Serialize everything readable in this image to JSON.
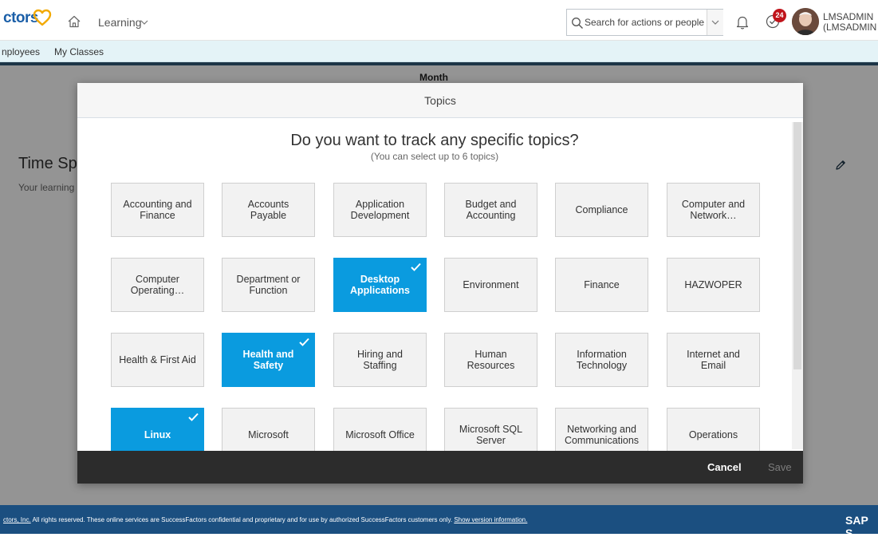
{
  "header": {
    "logo_text": "ctors",
    "module": "Learning",
    "search": {
      "placeholder": "Search for actions or people"
    },
    "todo_badge": "24",
    "user": {
      "line1": "LMSADMIN",
      "line2": "(LMSADMIN"
    }
  },
  "subnav": {
    "items": [
      "nployees",
      "My Classes"
    ]
  },
  "background": {
    "month_label": "Month",
    "time_spent_title": "Time Sp",
    "time_spent_sub": "Your learning"
  },
  "dialog": {
    "title": "Topics",
    "question": "Do you want to track any specific topics?",
    "hint": "(You can select up to 6 topics)",
    "topics": [
      {
        "label": "Accounting and Finance",
        "selected": false
      },
      {
        "label": "Accounts Payable",
        "selected": false
      },
      {
        "label": "Application Development",
        "selected": false
      },
      {
        "label": "Budget and Accounting",
        "selected": false
      },
      {
        "label": "Compliance",
        "selected": false
      },
      {
        "label": "Computer and Network…",
        "selected": false
      },
      {
        "label": "Computer Operating…",
        "selected": false
      },
      {
        "label": "Department or Function",
        "selected": false
      },
      {
        "label": "Desktop Applications",
        "selected": true
      },
      {
        "label": "Environment",
        "selected": false
      },
      {
        "label": "Finance",
        "selected": false
      },
      {
        "label": "HAZWOPER",
        "selected": false
      },
      {
        "label": "Health & First Aid",
        "selected": false
      },
      {
        "label": "Health and Safety",
        "selected": true
      },
      {
        "label": "Hiring and Staffing",
        "selected": false
      },
      {
        "label": "Human Resources",
        "selected": false
      },
      {
        "label": "Information Technology",
        "selected": false
      },
      {
        "label": "Internet and Email",
        "selected": false
      },
      {
        "label": "Linux",
        "selected": true
      },
      {
        "label": "Microsoft",
        "selected": false
      },
      {
        "label": "Microsoft Office",
        "selected": false
      },
      {
        "label": "Microsoft SQL Server",
        "selected": false
      },
      {
        "label": "Networking and Communications",
        "selected": false
      },
      {
        "label": "Operations",
        "selected": false
      }
    ],
    "cancel_label": "Cancel",
    "save_label": "Save"
  },
  "footer": {
    "company_link": "ctors, Inc.",
    "text": " All rights reserved. These online services are SuccessFactors confidential and proprietary and for use by authorized SuccessFactors customers only. ",
    "version_link": "Show version information.",
    "brand": "SAP S"
  },
  "colors": {
    "brand_blue": "#1b5fa8",
    "accent_selected": "#0a9bdf",
    "heart_gold": "#f2a900",
    "badge_red": "#c0141b",
    "footer_blue": "#1b4f80"
  }
}
